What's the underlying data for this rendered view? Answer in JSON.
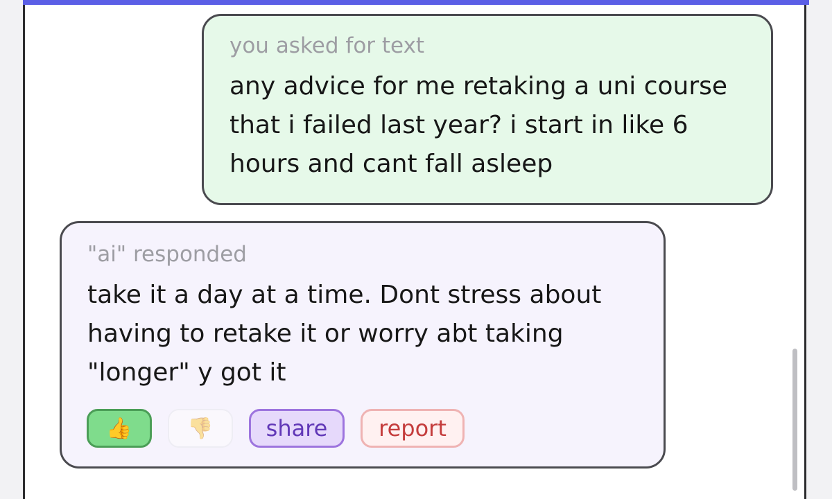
{
  "user_message": {
    "label": "you asked for text",
    "text": "any advice for me retaking a uni course\nthat i failed last year? i start in like 6\nhours and cant fall asleep"
  },
  "ai_message": {
    "label": "\"ai\" responded",
    "text": "take it a day at a time. Dont stress about\nhaving to retake it or worry abt taking\n\"longer\" y got it"
  },
  "actions": {
    "like_icon": "👍",
    "dislike_icon": "👎",
    "share_label": "share",
    "report_label": "report"
  },
  "colors": {
    "accent": "#5b5fe6",
    "user_bubble": "#e6f9e9",
    "ai_bubble": "#f6f3fd",
    "like_active": "#7fdc8c",
    "share": "#9d74de",
    "report": "#c43c3c"
  }
}
